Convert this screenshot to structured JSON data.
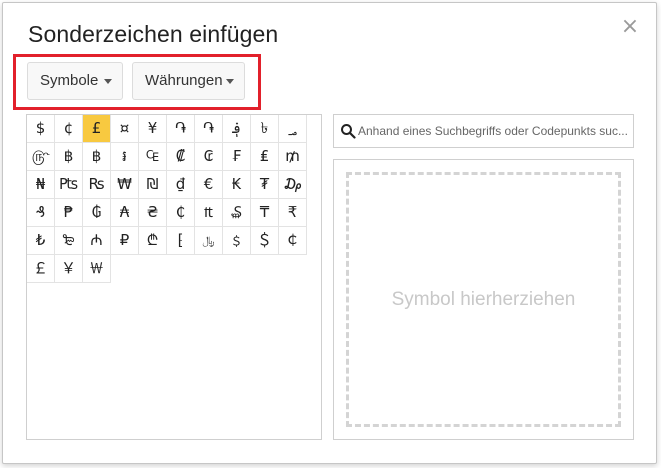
{
  "dialog": {
    "title": "Sonderzeichen einfügen",
    "close_glyph": "×"
  },
  "dropdowns": {
    "category": "Symbole",
    "subcategory": "Währungen"
  },
  "search": {
    "placeholder": "Anhand eines Suchbegriffs oder Codepunkts suc..."
  },
  "draw_area": {
    "label": "Symbol hierherziehen"
  },
  "symbols": {
    "selected_index": 2,
    "items": [
      "$",
      "¢",
      "£",
      "¤",
      "¥",
      "֏",
      "֏",
      "؋",
      "৳",
      "؃",
      "௹",
      "฿",
      "฿",
      "៛",
      "₠",
      "₡",
      "₢",
      "₣",
      "₤",
      "₥",
      "₦",
      "₧",
      "₨",
      "₩",
      "₪",
      "₫",
      "€",
      "₭",
      "₮",
      "₯",
      "₰",
      "₱",
      "₲",
      "₳",
      "₴",
      "₵",
      "₶",
      "₷",
      "₸",
      "₹",
      "₺",
      "₻",
      "₼",
      "₽",
      "₾",
      "⁅",
      "﷼",
      "﹩",
      "＄",
      "￠",
      "￡",
      "￥",
      "￦"
    ]
  },
  "colors": {
    "selected_cell": "#f8c940",
    "highlight_box": "#e2202b"
  }
}
